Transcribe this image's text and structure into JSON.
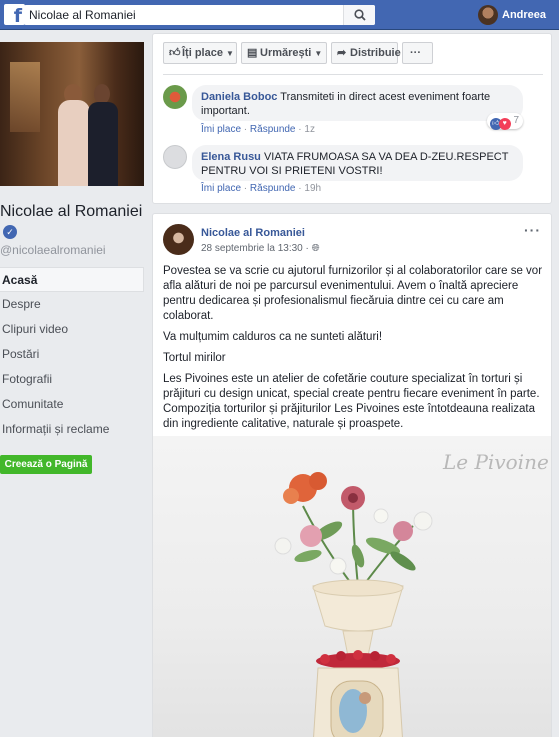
{
  "header": {
    "logo": "f",
    "search_value": "Nicolae al Romaniei",
    "user_name": "Andreea"
  },
  "page": {
    "name": "Nicolae al Romaniei",
    "handle": "@nicolaealromaniei"
  },
  "nav": {
    "items": [
      {
        "label": "Acasă",
        "active": true
      },
      {
        "label": "Despre"
      },
      {
        "label": "Clipuri video"
      },
      {
        "label": "Postări"
      },
      {
        "label": "Fotografii"
      },
      {
        "label": "Comunitate"
      },
      {
        "label": "Informații și reclame"
      }
    ],
    "create_page": "Creează o Pagină"
  },
  "post_actions": {
    "like": "Îți place",
    "follow": "Urmărești",
    "share": "Distribuie",
    "more": "···"
  },
  "comments": [
    {
      "author": "Daniela Boboc",
      "text": "Transmiteti in direct acest eveniment foarte important.",
      "like_link": "Îmi place",
      "reply_link": "Răspunde",
      "time": "1z",
      "reaction_count": "7"
    },
    {
      "author": "Elena Rusu",
      "text": "VIATA FRUMOASA SA VA DEA D-ZEU.RESPECT PENTRU VOI SI PRIETENI VOSTRI!",
      "like_link": "Îmi place",
      "reply_link": "Răspunde",
      "time": "19h"
    }
  ],
  "post": {
    "author": "Nicolae al Romaniei",
    "date": "28 septembrie la 13:30",
    "more": "···",
    "paragraphs": [
      "Povestea se va scrie cu ajutorul furnizorilor și al colaboratorilor care se vor afla alături de noi pe parcursul evenimentului. Avem o înaltă apreciere pentru dedicarea și profesionalismul fiecăruia dintre cei cu care am colaborat.",
      "Va mulțumim calduros ca ne sunteti alături!",
      "Tortul mirilor",
      "Les Pivoines este un atelier de cofetărie couture specializat în torturi și prăjituri cu design unicat, special create pentru fiecare eveniment în parte. Compoziția torturilor și prăjiturilor Les Pivoines este întotdeauna realizata din ingrediente calitative, naturale și proaspete."
    ],
    "photo_watermark": "Le Pivoine"
  }
}
